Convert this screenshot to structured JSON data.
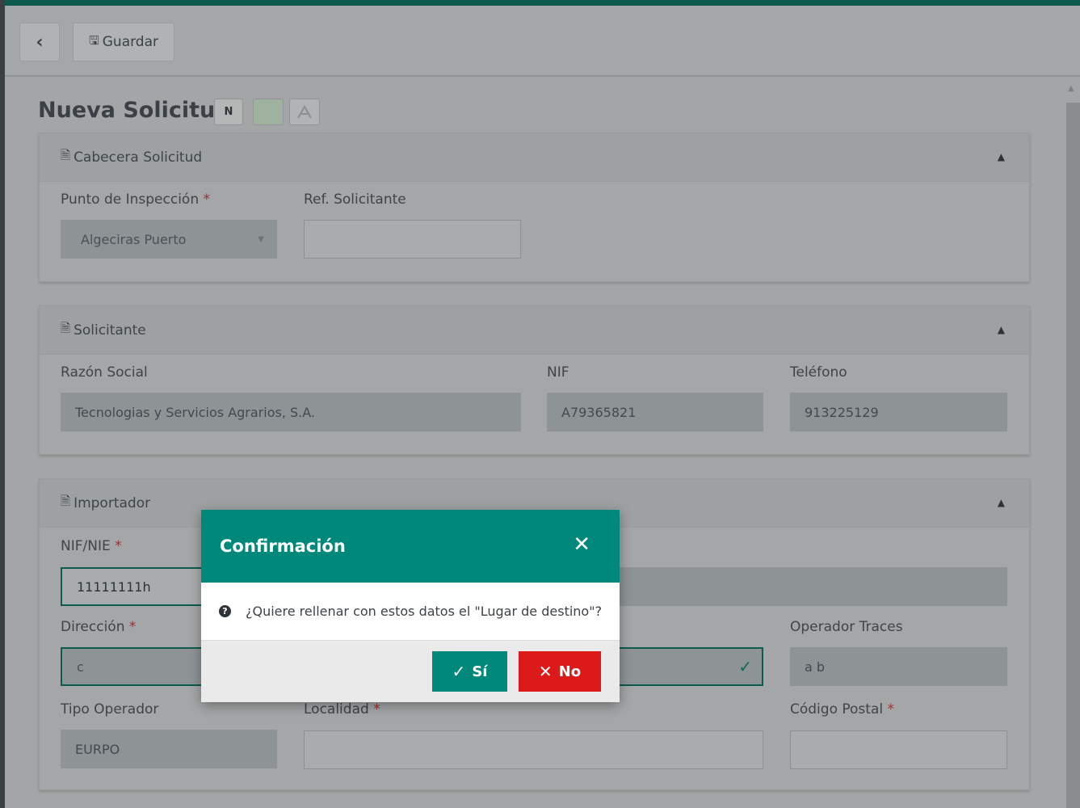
{
  "toolbar": {
    "back_icon": "chevron-left-icon",
    "back_glyph": "‹",
    "save_icon": "save-icon",
    "save_glyph": "🖫",
    "save_label": "Guardar"
  },
  "page": {
    "title": "Nueva Solicitud",
    "badges": [
      "N",
      "",
      "⚠"
    ]
  },
  "cabecera": {
    "title": "Cabecera Solicitud",
    "punto_label": "Punto de Inspección",
    "punto_value": "Algeciras Puerto",
    "ref_label": "Ref. Solicitante",
    "ref_value": ""
  },
  "solicitante": {
    "title": "Solicitante",
    "razon_label": "Razón Social",
    "razon_value": "Tecnologias y Servicios Agrarios, S.A.",
    "nif_label": "NIF",
    "nif_value": "A79365821",
    "telefono_label": "Teléfono",
    "telefono_value": "913225129"
  },
  "importador": {
    "title": "Importador",
    "nifnie_label": "NIF/NIE",
    "nifnie_value": "11111111h",
    "direccion_label": "Dirección",
    "direccion_value": "c",
    "operador_label": "Operador Traces",
    "operador_value": "a b",
    "tipo_label": "Tipo Operador",
    "tipo_value": "EURPO",
    "localidad_label": "Localidad",
    "localidad_value": "",
    "cp_label": "Código Postal",
    "cp_value": ""
  },
  "required_mark": "*",
  "panel_icon": "document-icon",
  "panel_glyph": "🗎",
  "caret_glyph": "▲",
  "modal": {
    "title": "Confirmación",
    "close_glyph": "✕",
    "message": "¿Quiere rellenar con estos datos el \"Lugar de destino\"?",
    "question_glyph": "?",
    "yes_label": "Sí",
    "yes_glyph": "✓",
    "no_label": "No",
    "no_glyph": "✕"
  },
  "colors": {
    "accent": "#00897b",
    "danger": "#dd1a1a",
    "dark_teal": "#0e5a4f"
  }
}
